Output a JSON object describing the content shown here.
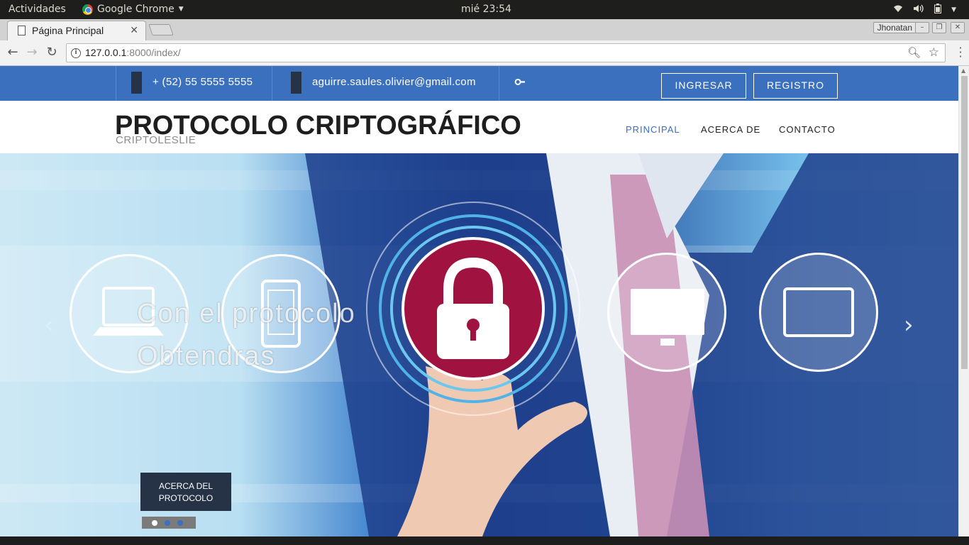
{
  "system_bar": {
    "activities": "Actividades",
    "app_name": "Google Chrome",
    "clock": "mié 23:54"
  },
  "browser": {
    "tab_title": "Página Principal",
    "profile_name": "Jhonatan",
    "url_host": "127.0.0.1",
    "url_rest": ":8000/index/"
  },
  "topbar": {
    "phone": "+ (52) 55 5555 5555",
    "email": "aguirre.saules.olivier@gmail.com",
    "login_label": "INGRESAR",
    "register_label": "REGISTRO"
  },
  "header": {
    "title": "PROTOCOLO CRIPTOGRÁFICO",
    "subtitle": "CRIPTOLESLIE",
    "nav": [
      {
        "label": "PRINCIPAL"
      },
      {
        "label": "ACERCA DE"
      },
      {
        "label": "CONTACTO"
      }
    ],
    "active_nav": "PRINCIPAL"
  },
  "hero": {
    "caption": "Con el protocolo\nObtendras",
    "button_label": "ACERCA DEL PROTOCOLO",
    "slides_total": 3,
    "active_slide": 1
  },
  "colors": {
    "primary_blue": "#3b70bf",
    "dark_navy": "#263246",
    "lock_red": "#a0123f"
  }
}
